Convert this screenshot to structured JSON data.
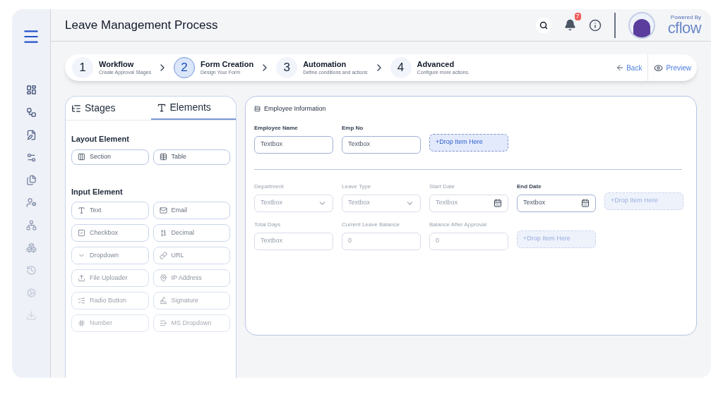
{
  "header": {
    "title": "Leave Management Process",
    "notification_count": "7",
    "brand": {
      "tagline": "Powered By",
      "name": "cflow"
    }
  },
  "stepper": {
    "steps": [
      {
        "number": "1",
        "title": "Workflow",
        "subtitle": "Create Approval Stages",
        "selected": false
      },
      {
        "number": "2",
        "title": "Form Creation",
        "subtitle": "Design Your Form",
        "selected": true
      },
      {
        "number": "3",
        "title": "Automation",
        "subtitle": "Define conditions and actions",
        "selected": false
      },
      {
        "number": "4",
        "title": "Advanced",
        "subtitle": "Configure more actions.",
        "selected": false
      }
    ],
    "back": "Back",
    "preview": "Preview"
  },
  "palette": {
    "tabs": [
      {
        "label": "Stages",
        "selected": false
      },
      {
        "label": "Elements",
        "selected": true
      }
    ],
    "layout_heading": "Layout Element",
    "layout_items": [
      {
        "label": "Section"
      },
      {
        "label": "Table"
      }
    ],
    "input_heading": "Input Element",
    "input_items": [
      {
        "label": "Text"
      },
      {
        "label": "Email"
      },
      {
        "label": "Checkbox"
      },
      {
        "label": "Decimal"
      },
      {
        "label": "Dropdown"
      },
      {
        "label": "URL"
      },
      {
        "label": "File Uploader"
      },
      {
        "label": "IP Address"
      },
      {
        "label": "Radio Button"
      },
      {
        "label": "Signature"
      },
      {
        "label": "Number"
      },
      {
        "label": "MS Dropdown"
      }
    ]
  },
  "form": {
    "section_title": "Employee Information",
    "rows": [
      [
        {
          "kind": "textbox",
          "label": "Employee Name",
          "value": "Textbox",
          "disabled": false
        },
        {
          "kind": "textbox",
          "label": "Emp No",
          "value": "Textbox",
          "disabled": false
        },
        {
          "kind": "drop",
          "label": "+Drop Item Here",
          "disabled": false
        }
      ],
      [
        {
          "kind": "dropdown",
          "label": "Department",
          "value": "Textbox",
          "disabled": true
        },
        {
          "kind": "dropdown",
          "label": "Leave Type",
          "value": "Textbox",
          "disabled": true
        },
        {
          "kind": "date",
          "label": "Start Date",
          "value": "Textbox",
          "disabled": true
        },
        {
          "kind": "date",
          "label": "End Date",
          "value": "Textbox",
          "disabled": false
        },
        {
          "kind": "drop",
          "label": "+Drop Item Here",
          "disabled": true
        }
      ],
      [
        {
          "kind": "textbox",
          "label": "Total Days",
          "value": "Textbox",
          "disabled": true
        },
        {
          "kind": "textbox",
          "label": "Current Leave Balance",
          "value": "0",
          "disabled": true
        },
        {
          "kind": "textbox",
          "label": "Balance After Approval",
          "value": "0",
          "disabled": true
        },
        {
          "kind": "drop",
          "label": "+Drop Item Here",
          "disabled": true
        }
      ]
    ]
  }
}
